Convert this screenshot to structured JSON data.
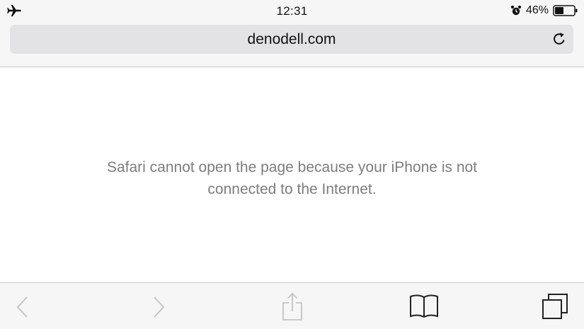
{
  "status_bar": {
    "time": "12:31",
    "battery_percent": "46%",
    "battery_level": 0.46,
    "airplane_mode": true,
    "alarm_set": true
  },
  "address_bar": {
    "url": "denodell.com"
  },
  "content": {
    "error_line_1": "Safari cannot open the page because your iPhone is not",
    "error_line_2": "connected to the Internet."
  },
  "toolbar": {
    "icons": [
      "back-icon",
      "forward-icon",
      "share-icon",
      "bookmarks-icon",
      "tabs-icon"
    ],
    "back_enabled": false,
    "forward_enabled": false,
    "share_enabled": false
  },
  "colors": {
    "chrome_bg": "#f6f6f6",
    "url_field_bg": "#e3e3e5",
    "message_text": "#7d7d7d",
    "disabled_icon": "#c4c4c4",
    "active_icon": "#222222"
  }
}
